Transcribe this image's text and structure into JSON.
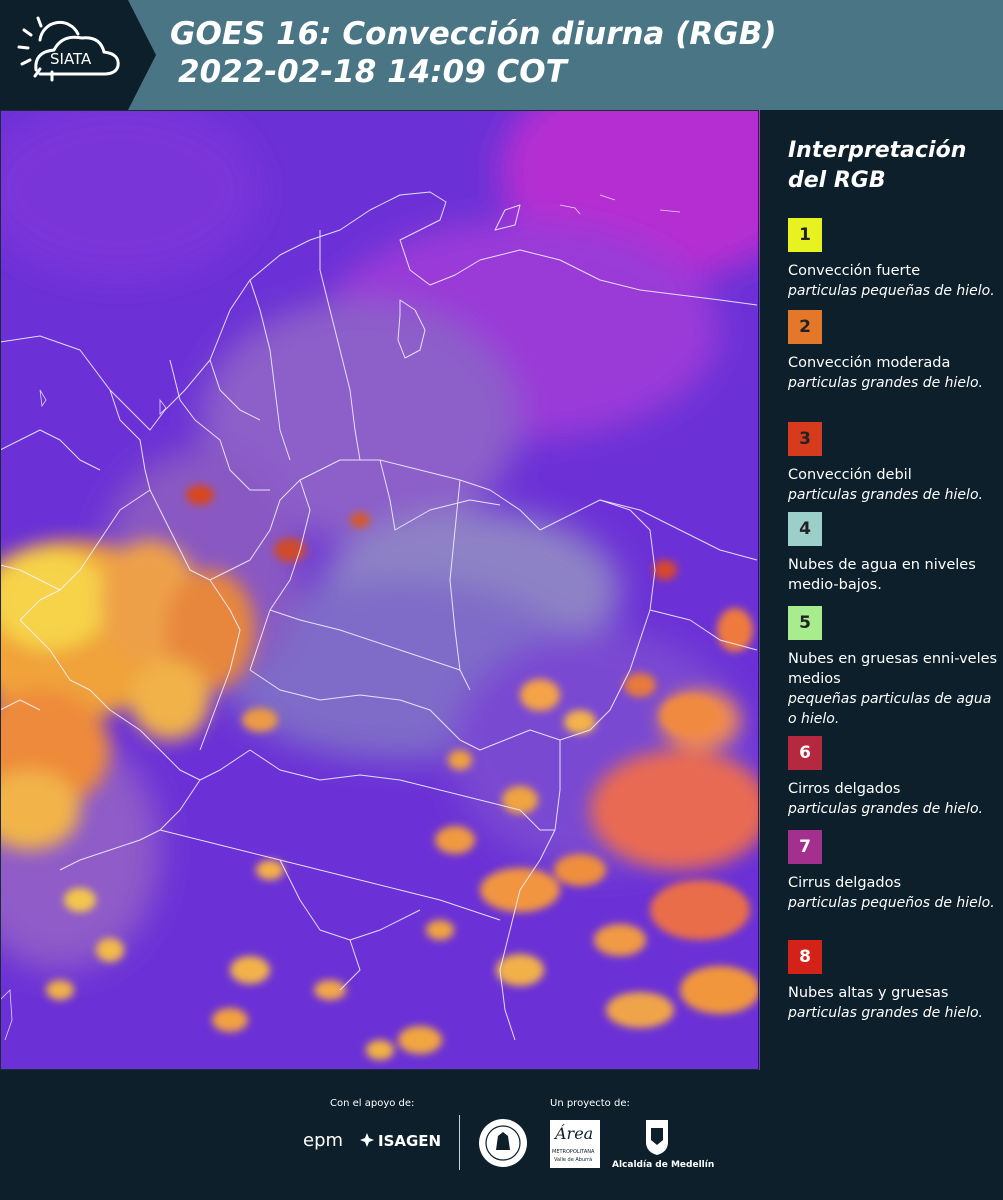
{
  "header": {
    "logo_text": "SIATA",
    "title_line1": "GOES 16: Convección diurna (RGB)",
    "title_line2": "2022-02-18 14:09 COT"
  },
  "legend": {
    "title": "Interpretación del RGB",
    "items": [
      {
        "num": "1",
        "color": "#e9f221",
        "label": "Convección fuerte",
        "desc": "particulas pequeñas de hielo."
      },
      {
        "num": "2",
        "color": "#e3782a",
        "label": "Convección moderada",
        "desc": "particulas grandes de hielo."
      },
      {
        "num": "3",
        "color": "#d53b1c",
        "label": "Convección debil",
        "desc": "particulas grandes de hielo."
      },
      {
        "num": "4",
        "color": "#9ccfc9",
        "label": "Nubes de agua en niveles medio-bajos.",
        "desc": ""
      },
      {
        "num": "5",
        "color": "#a8ec8d",
        "label": "Nubes en gruesas enni-veles medios",
        "desc": "pequeñas particulas de agua o hielo."
      },
      {
        "num": "6",
        "color": "#b6283f",
        "label": "Cirros delgados",
        "desc": "particulas grandes de hielo."
      },
      {
        "num": "7",
        "color": "#a4308d",
        "label": "Cirrus delgados",
        "desc": "particulas pequeños de hielo."
      },
      {
        "num": "8",
        "color": "#d52218",
        "label": "Nubes altas y gruesas",
        "desc": "particulas grandes de hielo."
      }
    ]
  },
  "footer": {
    "support_label": "Con el apoyo de:",
    "project_label": "Un proyecto de:",
    "sponsor1": "epm",
    "sponsor2": "ISAGEN",
    "partner1_icon": "medellin-seal-icon",
    "partner2": "Área",
    "partner2_sub": "METROPOLITANA",
    "partner2_sub2": "Valle de Aburrá",
    "partner3": "Alcaldía de Medellín"
  },
  "colors": {
    "header_bg": "#4a7584",
    "panel_bg": "#0c1f2b",
    "map_base": "#6a2fd8"
  }
}
